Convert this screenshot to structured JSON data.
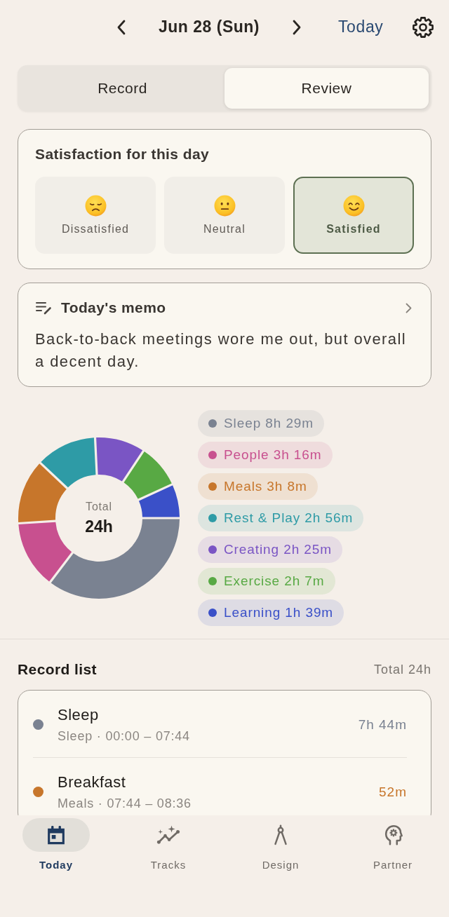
{
  "header": {
    "date": "Jun 28 (Sun)",
    "today_link": "Today"
  },
  "tabs": [
    {
      "label": "Record",
      "selected": false
    },
    {
      "label": "Review",
      "selected": true
    }
  ],
  "satisfaction": {
    "title": "Satisfaction for this day",
    "options": [
      {
        "label": "Dissatisfied",
        "selected": false
      },
      {
        "label": "Neutral",
        "selected": false
      },
      {
        "label": "Satisfied",
        "selected": true
      }
    ]
  },
  "memo": {
    "title": "Today's memo",
    "text": "Back-to-back meetings wore me out, but overall a decent day."
  },
  "breakdown": {
    "total_label": "Total",
    "total_value": "24h",
    "legend": [
      {
        "label": "Sleep 8h 29m",
        "color": "#7a8291"
      },
      {
        "label": "People 3h 16m",
        "color": "#c8508f"
      },
      {
        "label": "Meals 3h 8m",
        "color": "#c7762b"
      },
      {
        "label": "Rest & Play 2h 56m",
        "color": "#2e9ba6"
      },
      {
        "label": "Creating 2h 25m",
        "color": "#7a55c4"
      },
      {
        "label": "Exercise 2h 7m",
        "color": "#58a944"
      },
      {
        "label": "Learning 1h 39m",
        "color": "#3a50c8"
      }
    ],
    "chart_data": {
      "type": "donut",
      "values": [
        35.35,
        13.61,
        13.06,
        12.22,
        10.07,
        8.82,
        6.87
      ]
    }
  },
  "record_list": {
    "title": "Record list",
    "total": "Total 24h",
    "records": [
      {
        "title": "Sleep",
        "subtitle": "Sleep · 00:00 – 07:44",
        "duration": "7h 44m",
        "color": "#7a8291"
      },
      {
        "title": "Breakfast",
        "subtitle": "Meals · 07:44 – 08:36",
        "duration": "52m",
        "color": "#c7762b"
      }
    ]
  },
  "nav": [
    {
      "label": "Today",
      "selected": true
    },
    {
      "label": "Tracks",
      "selected": false
    },
    {
      "label": "Design",
      "selected": false
    },
    {
      "label": "Partner",
      "selected": false
    }
  ]
}
